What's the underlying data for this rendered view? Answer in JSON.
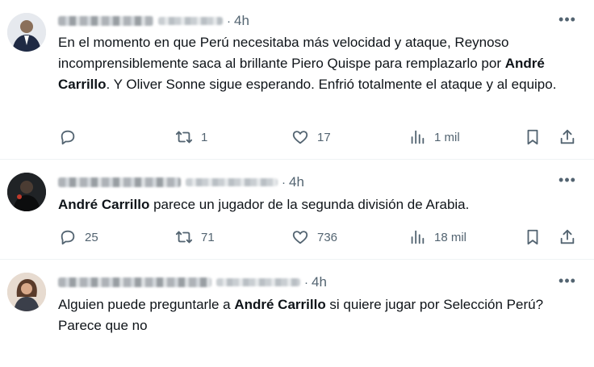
{
  "tweets": [
    {
      "time": "4h",
      "separator": "·",
      "text_parts": [
        "En el momento en que Perú necesitaba más velocidad y ataque, Reynoso incomprensiblemente saca al brillante Piero Quispe para remplazarlo por ",
        "André Carrillo",
        ". Y Oliver Sonne sigue esperando. Enfrió totalmente el ataque y al equipo."
      ],
      "replies": "",
      "retweets": "1",
      "likes": "17",
      "views": "1 mil"
    },
    {
      "time": "4h",
      "separator": "·",
      "text_parts": [
        "",
        "André Carrillo",
        " parece un jugador de la segunda división de Arabia."
      ],
      "replies": "25",
      "retweets": "71",
      "likes": "736",
      "views": "18 mil"
    },
    {
      "time": "4h",
      "separator": "·",
      "text_parts": [
        "Alguien puede preguntarle a ",
        "André Carrillo",
        " si quiere jugar por Selección Perú?"
      ],
      "text_line2": "Parece que no"
    }
  ],
  "icons": {
    "reply": "reply-icon",
    "retweet": "retweet-icon",
    "like": "heart-icon",
    "views": "views-icon",
    "bookmark": "bookmark-icon",
    "share": "share-icon",
    "more": "more-icon"
  },
  "colors": {
    "text": "#0f1419",
    "muted": "#536471",
    "divider": "#eff3f4"
  }
}
